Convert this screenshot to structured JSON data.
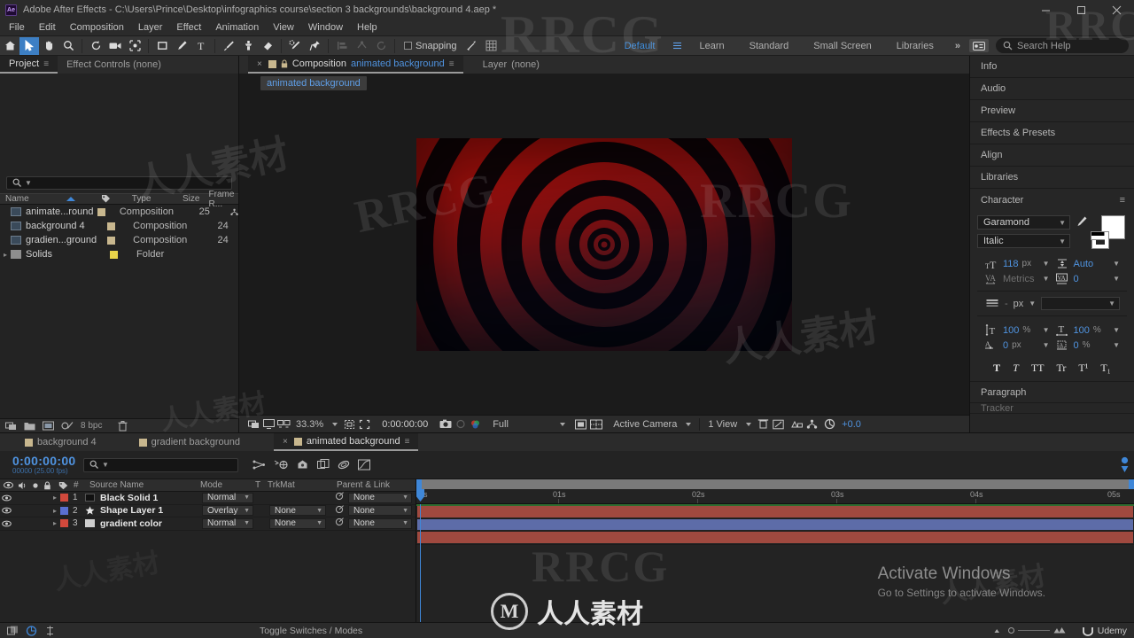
{
  "window": {
    "app_icon": "Ae",
    "title": "Adobe After Effects - C:\\Users\\Prince\\Desktop\\infographics course\\section 3 backgrounds\\background 4.aep *",
    "minimize": "minimize-button",
    "maximize": "maximize-button",
    "close": "close-button"
  },
  "menu": {
    "items": [
      "File",
      "Edit",
      "Composition",
      "Layer",
      "Effect",
      "Animation",
      "View",
      "Window",
      "Help"
    ]
  },
  "toolbar": {
    "snapping_label": "Snapping",
    "workspaces": [
      {
        "label": "Default",
        "selected": true
      },
      {
        "label": "Learn",
        "selected": false
      },
      {
        "label": "Standard",
        "selected": false
      },
      {
        "label": "Small Screen",
        "selected": false
      },
      {
        "label": "Libraries",
        "selected": false
      }
    ],
    "overflow": "»",
    "search_placeholder": "Search Help"
  },
  "project_panel": {
    "tabs": [
      {
        "label": "Project",
        "active": true
      },
      {
        "label": "Effect Controls (none)",
        "active": false
      }
    ],
    "search_value": "",
    "columns": [
      "Name",
      "Type",
      "Size",
      "Frame R..."
    ],
    "items": [
      {
        "name": "animate...round",
        "type": "Composition",
        "size": "",
        "frame_rate": "25",
        "kind": "comp",
        "swatch": "#c8b78e"
      },
      {
        "name": "background 4",
        "type": "Composition",
        "size": "",
        "frame_rate": "24",
        "kind": "comp",
        "swatch": "#c8b78e"
      },
      {
        "name": "gradien...ground",
        "type": "Composition",
        "size": "",
        "frame_rate": "24",
        "kind": "comp",
        "swatch": "#c8b78e"
      },
      {
        "name": "Solids",
        "type": "Folder",
        "size": "",
        "frame_rate": "",
        "kind": "folder",
        "swatch": "#e8d44a"
      }
    ],
    "footer_bpc": "8 bpc"
  },
  "composition_panel": {
    "tabs": [
      {
        "label": "Composition",
        "comp_name": "animated background",
        "active": true
      },
      {
        "label": "Layer",
        "comp_name": "(none)",
        "active": false
      }
    ],
    "breadcrumb": "animated background",
    "viewer_bar": {
      "zoom": "33.3%",
      "timecode": "0:00:00:00",
      "resolution": "Full",
      "camera": "Active Camera",
      "views": "1 View",
      "exposure": "+0.0"
    }
  },
  "right_panels": {
    "items": [
      "Info",
      "Audio",
      "Preview",
      "Effects & Presets",
      "Align",
      "Libraries"
    ],
    "character": {
      "title": "Character",
      "font_family": "Garamond",
      "font_style": "Italic",
      "font_size": "118",
      "font_size_unit": "px",
      "leading": "Auto",
      "kerning": "Metrics",
      "tracking": "0",
      "stroke_width": "-",
      "stroke_width_unit": "px",
      "vertical_scale": "100",
      "horizontal_scale": "100",
      "scale_unit": "%",
      "baseline_shift": "0",
      "baseline_unit": "px",
      "tsume": "0",
      "tsume_unit": "%",
      "style_buttons": [
        "T",
        "T",
        "TT",
        "Tr",
        "T¹",
        "T₁"
      ]
    },
    "paragraph": "Paragraph",
    "tracker": "Tracker"
  },
  "timeline": {
    "tabs": [
      {
        "label": "background 4",
        "active": false
      },
      {
        "label": "gradient background",
        "active": false
      },
      {
        "label": "animated background",
        "active": true
      }
    ],
    "timecode": "0:00:00:00",
    "timecode_sub": "00000 (25.00 fps)",
    "search_value": "",
    "columns": [
      "#",
      "Source Name",
      "Mode",
      "T",
      "TrkMat",
      "Parent & Link"
    ],
    "layers": [
      {
        "index": "1",
        "name": "Black Solid 1",
        "mode": "Normal",
        "trkmat": "",
        "parent": "None",
        "label_color": "#d2493c",
        "icon_color": "#111111",
        "icon_type": "solid",
        "bar_color": "#a0493f"
      },
      {
        "index": "2",
        "name": "Shape Layer 1",
        "mode": "Overlay",
        "trkmat": "None",
        "parent": "None",
        "label_color": "#5a6fd0",
        "icon_color": "#e0e0e0",
        "icon_type": "shape",
        "bar_color": "#5d6ca8"
      },
      {
        "index": "3",
        "name": "gradient color",
        "mode": "Normal",
        "trkmat": "None",
        "parent": "None",
        "label_color": "#d2493c",
        "icon_color": "#cfcfcf",
        "icon_type": "solid",
        "bar_color": "#a0493f"
      }
    ],
    "ruler_ticks": [
      "0s",
      "01s",
      "02s",
      "03s",
      "04s",
      "05s"
    ],
    "toggle_switches_label": "Toggle Switches / Modes"
  },
  "overlay": {
    "activate_title": "Activate Windows",
    "activate_sub": "Go to Settings to activate Windows.",
    "udemy": "Udemy"
  },
  "watermarks": {
    "rrcg": "RRCG",
    "cn_main": "人人素材",
    "center": "人人素材"
  },
  "colors": {
    "accent_blue": "#3f87d8",
    "text_blue": "#4f93e0",
    "panel_bg": "#232323",
    "chrome_bg": "#2b2b2b"
  }
}
